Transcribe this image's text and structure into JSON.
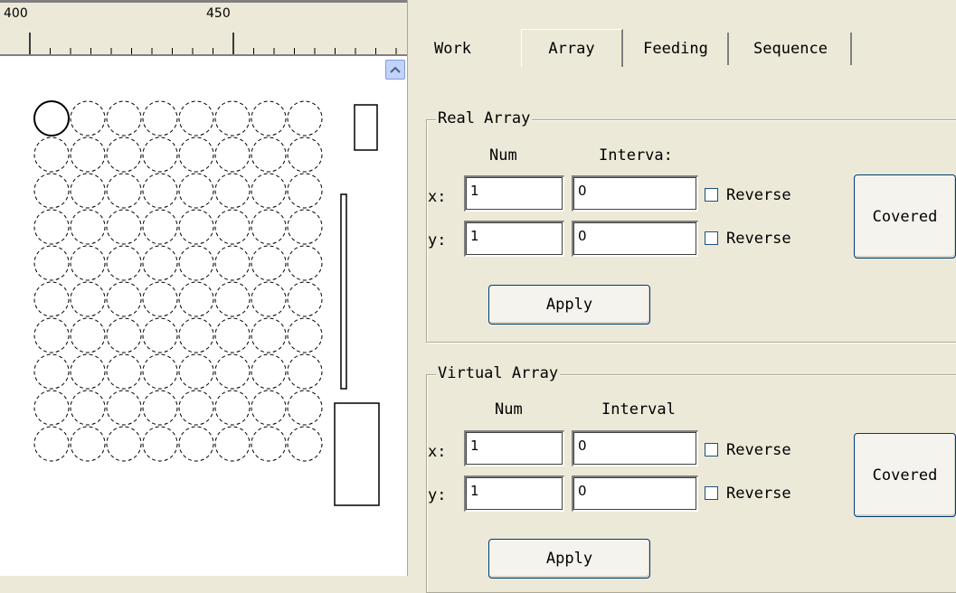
{
  "ruler": {
    "ticks": [
      "400",
      "450"
    ]
  },
  "canvas": {
    "scroll_icon": "chevron-up-icon",
    "grid_columns": 8,
    "grid_rows": 10
  },
  "tabs": [
    {
      "label": "Work",
      "active": false
    },
    {
      "label": "Array",
      "active": true
    },
    {
      "label": "Feeding",
      "active": false
    },
    {
      "label": "Sequence",
      "active": false
    }
  ],
  "real_array": {
    "title": "Real Array",
    "num_header": "Num",
    "interval_header": "Interva:",
    "x_label": "x:",
    "y_label": "y:",
    "x_num": "1",
    "x_interval": "0",
    "y_num": "1",
    "y_interval": "0",
    "reverse_label": "Reverse",
    "covered_label": "Covered",
    "apply_label": "Apply"
  },
  "virtual_array": {
    "title": "Virtual Array",
    "num_header": "Num",
    "interval_header": "Interval",
    "x_label": "x:",
    "y_label": "y:",
    "x_num": "1",
    "x_interval": "0",
    "y_num": "1",
    "y_interval": "0",
    "reverse_label": "Reverse",
    "covered_label": "Covered",
    "apply_label": "Apply"
  }
}
